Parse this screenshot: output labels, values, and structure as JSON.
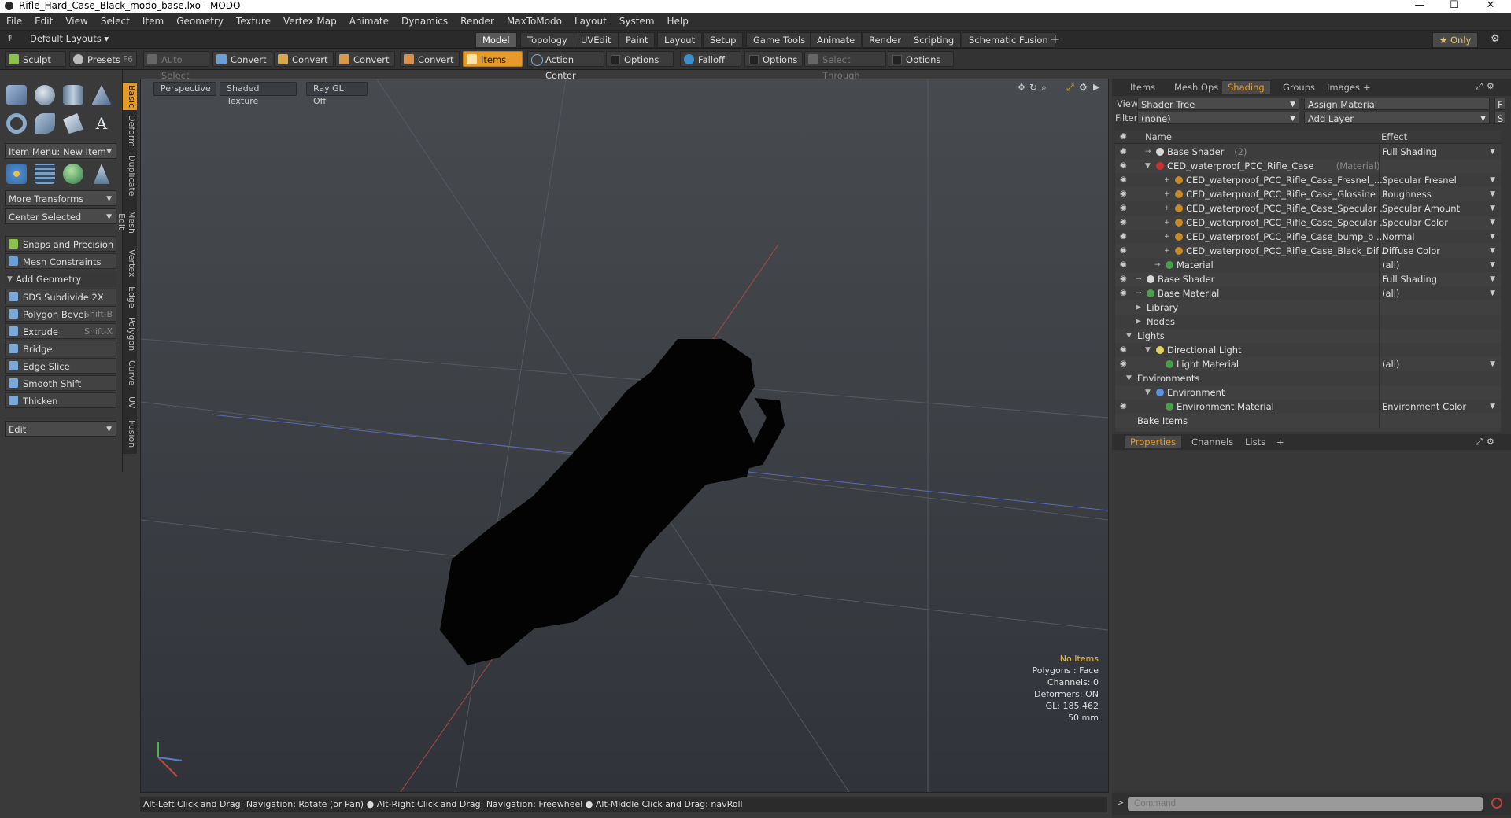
{
  "window": {
    "title": "Rifle_Hard_Case_Black_modo_base.lxo - MODO",
    "minimize": "—",
    "maximize": "☐",
    "close": "✕"
  },
  "menu": [
    "File",
    "Edit",
    "View",
    "Select",
    "Item",
    "Geometry",
    "Texture",
    "Vertex Map",
    "Animate",
    "Dynamics",
    "Render",
    "MaxToModo",
    "Layout",
    "System",
    "Help"
  ],
  "layout_bar": {
    "layouts_label": "Default Layouts",
    "tabs": [
      "Model",
      "Topology",
      "UVEdit",
      "Paint",
      "Layout",
      "Setup",
      "Game Tools",
      "Animate",
      "Render",
      "Scripting",
      "Schematic Fusion"
    ],
    "active_tab": "Model",
    "add": "+",
    "only_label": "★ Only"
  },
  "toolrow": {
    "sculpt": "Sculpt",
    "presets": "Presets",
    "presets_key": "F6",
    "auto_select": "Auto Select",
    "convert1": "Convert",
    "convert2": "Convert",
    "convert3": "Convert",
    "convert4": "Convert",
    "items": "Items",
    "action_center": "Action Center",
    "options1": "Options",
    "falloff": "Falloff",
    "options2": "Options",
    "select_through": "Select Through",
    "options3": "Options"
  },
  "left_panel": {
    "item_menu": "Item Menu: New Item",
    "more_transforms": "More Transforms",
    "center_selected": "Center Selected",
    "snaps": "Snaps and Precision",
    "mesh_constraints": "Mesh Constraints",
    "add_geometry": "Add Geometry",
    "tools": [
      {
        "label": "SDS Subdivide 2X",
        "shortcut": ""
      },
      {
        "label": "Polygon Bevel",
        "shortcut": "Shift-B"
      },
      {
        "label": "Extrude",
        "shortcut": "Shift-X"
      },
      {
        "label": "Bridge",
        "shortcut": ""
      },
      {
        "label": "Edge Slice",
        "shortcut": ""
      },
      {
        "label": "Smooth Shift",
        "shortcut": ""
      },
      {
        "label": "Thicken",
        "shortcut": ""
      }
    ],
    "edit_dropdown": "Edit",
    "vtabs": [
      "Basic",
      "Deform",
      "Duplicate",
      "Mesh Edit",
      "Vertex",
      "Edge",
      "Polygon",
      "Curve",
      "UV",
      "Fusion"
    ]
  },
  "viewport": {
    "perspective": "Perspective",
    "shaded_texture": "Shaded Texture",
    "ray_gl": "Ray GL: Off",
    "info": {
      "no_items": "No Items",
      "polygons": "Polygons : Face",
      "channels": "Channels: 0",
      "deformers": "Deformers: ON",
      "gl": "GL: 185,462",
      "mm": "50 mm"
    }
  },
  "status_bar": "Alt-Left Click and Drag: Navigation: Rotate (or Pan) ● Alt-Right Click and Drag: Navigation: Freewheel ● Alt-Middle Click and Drag: navRoll",
  "right_panel": {
    "tabs": [
      "Items",
      "Mesh Ops",
      "Shading",
      "Groups",
      "Images"
    ],
    "active_tab": "Shading",
    "add": "+",
    "view_label": "View",
    "view_value": "Shader Tree",
    "assign_material": "Assign Material",
    "filter_label": "Filter",
    "filter_value": "(none)",
    "add_layer": "Add Layer",
    "f_btn": "F",
    "s_btn": "S",
    "col_name": "Name",
    "col_effect": "Effect",
    "rows": [
      {
        "indent": 52,
        "name": "Base Shader",
        "suffix": "(2)",
        "effect": "Full Shading",
        "eye": true,
        "dot": "#d8d8d8",
        "exp": "→"
      },
      {
        "indent": 52,
        "name": "CED_waterproof_PCC_Rifle_Case",
        "suffix": "(Material)",
        "effect": "",
        "eye": true,
        "dot": "#c93030",
        "exp": "▼"
      },
      {
        "indent": 76,
        "name": "CED_waterproof_PCC_Rifle_Case_Fresnel_...",
        "suffix": "",
        "effect": "Specular Fresnel",
        "eye": true,
        "dot": "#c58a2a",
        "exp": "+"
      },
      {
        "indent": 76,
        "name": "CED_waterproof_PCC_Rifle_Case_Glossine ...",
        "suffix": "",
        "effect": "Roughness",
        "eye": true,
        "dot": "#c58a2a",
        "exp": "+"
      },
      {
        "indent": 76,
        "name": "CED_waterproof_PCC_Rifle_Case_Specular ...",
        "suffix": "",
        "effect": "Specular Amount",
        "eye": true,
        "dot": "#c58a2a",
        "exp": "+"
      },
      {
        "indent": 76,
        "name": "CED_waterproof_PCC_Rifle_Case_Specular ...",
        "suffix": "",
        "effect": "Specular Color",
        "eye": true,
        "dot": "#c58a2a",
        "exp": "+"
      },
      {
        "indent": 76,
        "name": "CED_waterproof_PCC_Rifle_Case_bump_b ...",
        "suffix": "",
        "effect": "Normal",
        "eye": true,
        "dot": "#c58a2a",
        "exp": "+"
      },
      {
        "indent": 76,
        "name": "CED_waterproof_PCC_Rifle_Case_Black_Dif...",
        "suffix": "",
        "effect": "Diffuse Color",
        "eye": true,
        "dot": "#c58a2a",
        "exp": "+"
      },
      {
        "indent": 64,
        "name": "Material",
        "suffix": "",
        "effect": "(all)",
        "eye": true,
        "dot": "#4aa04a",
        "exp": "→"
      },
      {
        "indent": 40,
        "name": "Base Shader",
        "suffix": "",
        "effect": "Full Shading",
        "eye": true,
        "dot": "#d8d8d8",
        "exp": "→"
      },
      {
        "indent": 40,
        "name": "Base Material",
        "suffix": "",
        "effect": "(all)",
        "eye": true,
        "dot": "#4aa04a",
        "exp": "→"
      },
      {
        "indent": 40,
        "name": "Library",
        "suffix": "",
        "effect": "",
        "eye": false,
        "dot": "",
        "exp": "▶"
      },
      {
        "indent": 40,
        "name": "Nodes",
        "suffix": "",
        "effect": "",
        "eye": false,
        "dot": "",
        "exp": "▶"
      },
      {
        "indent": 28,
        "name": "Lights",
        "suffix": "",
        "effect": "",
        "eye": false,
        "dot": "",
        "exp": "▼"
      },
      {
        "indent": 52,
        "name": "Directional Light",
        "suffix": "",
        "effect": "",
        "eye": true,
        "dot": "#e0d060",
        "exp": "▼"
      },
      {
        "indent": 64,
        "name": "Light Material",
        "suffix": "",
        "effect": "(all)",
        "eye": true,
        "dot": "#4aa04a",
        "exp": ""
      },
      {
        "indent": 28,
        "name": "Environments",
        "suffix": "",
        "effect": "",
        "eye": false,
        "dot": "",
        "exp": "▼"
      },
      {
        "indent": 52,
        "name": "Environment",
        "suffix": "",
        "effect": "",
        "eye": false,
        "dot": "#6090e0",
        "exp": "▼"
      },
      {
        "indent": 64,
        "name": "Environment Material",
        "suffix": "",
        "effect": "Environment Color",
        "eye": true,
        "dot": "#4aa04a",
        "exp": ""
      },
      {
        "indent": 28,
        "name": "Bake Items",
        "suffix": "",
        "effect": "",
        "eye": false,
        "dot": "",
        "exp": ""
      }
    ],
    "props_tabs": [
      "Properties",
      "Channels",
      "Lists"
    ],
    "props_active": "Properties",
    "command_placeholder": "Command"
  },
  "colors": {
    "accent": "#e59b2b",
    "panel": "#3a3a3a"
  }
}
